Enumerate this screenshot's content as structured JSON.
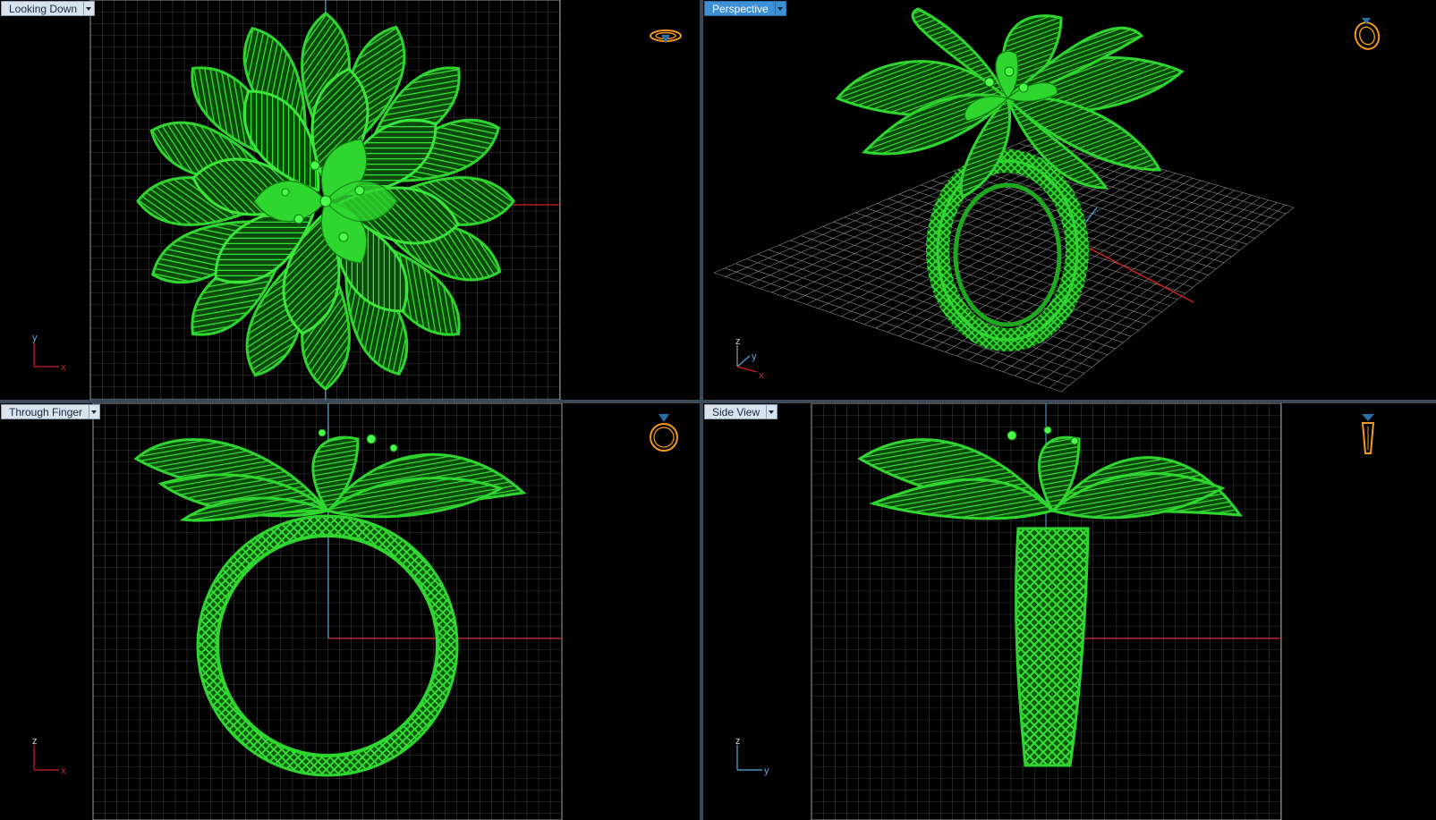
{
  "viewports": [
    {
      "label": "Looking Down",
      "active": false,
      "axes": [
        "y",
        "x"
      ]
    },
    {
      "label": "Perspective",
      "active": true,
      "axes": [
        "z",
        "y",
        "x"
      ]
    },
    {
      "label": "Through Finger",
      "active": false,
      "axes": [
        "z",
        "x"
      ]
    },
    {
      "label": "Side View",
      "active": false,
      "axes": [
        "z",
        "y"
      ]
    }
  ],
  "colors": {
    "model": "#2fd62f",
    "model_dark": "#0f7a0f",
    "grid": "#8a8a8a",
    "x_axis": "#d42020",
    "y_axis": "#4fb0e0",
    "gizmo": "#f29a1c"
  },
  "icons": [
    "ring-orientation-icon",
    "ring-perspective-icon",
    "ring-front-icon",
    "ring-side-icon"
  ]
}
